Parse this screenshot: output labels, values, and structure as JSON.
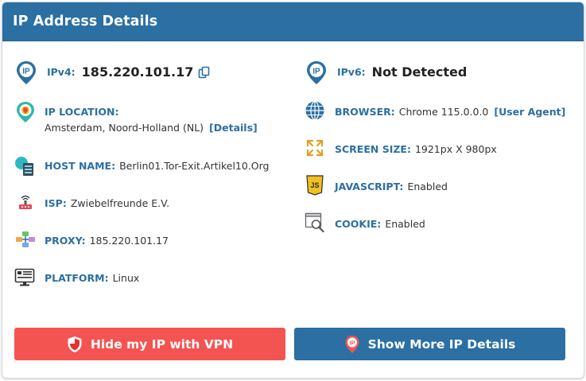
{
  "header": {
    "title": "IP Address Details"
  },
  "left": {
    "ipv4": {
      "label": "IPv4:",
      "value": "185.220.101.17"
    },
    "location": {
      "label": "IP LOCATION:",
      "value": "Amsterdam, Noord-Holland (NL)",
      "link": "[Details]"
    },
    "host": {
      "label": "HOST NAME:",
      "value": "Berlin01.Tor-Exit.Artikel10.Org"
    },
    "isp": {
      "label": "ISP:",
      "value": "Zwiebelfreunde E.V."
    },
    "proxy": {
      "label": "PROXY:",
      "value": "185.220.101.17"
    },
    "platform": {
      "label": "PLATFORM:",
      "value": "Linux"
    }
  },
  "right": {
    "ipv6": {
      "label": "IPv6:",
      "value": "Not Detected"
    },
    "browser": {
      "label": "BROWSER:",
      "value": "Chrome 115.0.0.0",
      "link": "[User Agent]"
    },
    "screen": {
      "label": "SCREEN SIZE:",
      "value": "1921px X 980px"
    },
    "javascript": {
      "label": "JAVASCRIPT:",
      "value": "Enabled"
    },
    "cookie": {
      "label": "COOKIE:",
      "value": "Enabled"
    }
  },
  "buttons": {
    "vpn": "Hide my IP with VPN",
    "more": "Show More IP Details"
  },
  "icons": {
    "ipv4": "ip-pin-icon",
    "copy": "copy-icon",
    "location": "location-pin-icon",
    "host": "server-icon",
    "isp": "isp-icon",
    "proxy": "proxy-icon",
    "platform": "monitor-icon",
    "ipv6": "ip-pin-icon",
    "browser": "globe-icon",
    "screen": "expand-icon",
    "javascript": "js-icon",
    "cookie": "cookie-search-icon",
    "vpn": "shield-icon",
    "more": "ip-pin-icon"
  },
  "colors": {
    "primary": "#2b6fa3",
    "vpn_button": "#f45451",
    "header": "#2b6fa3"
  }
}
